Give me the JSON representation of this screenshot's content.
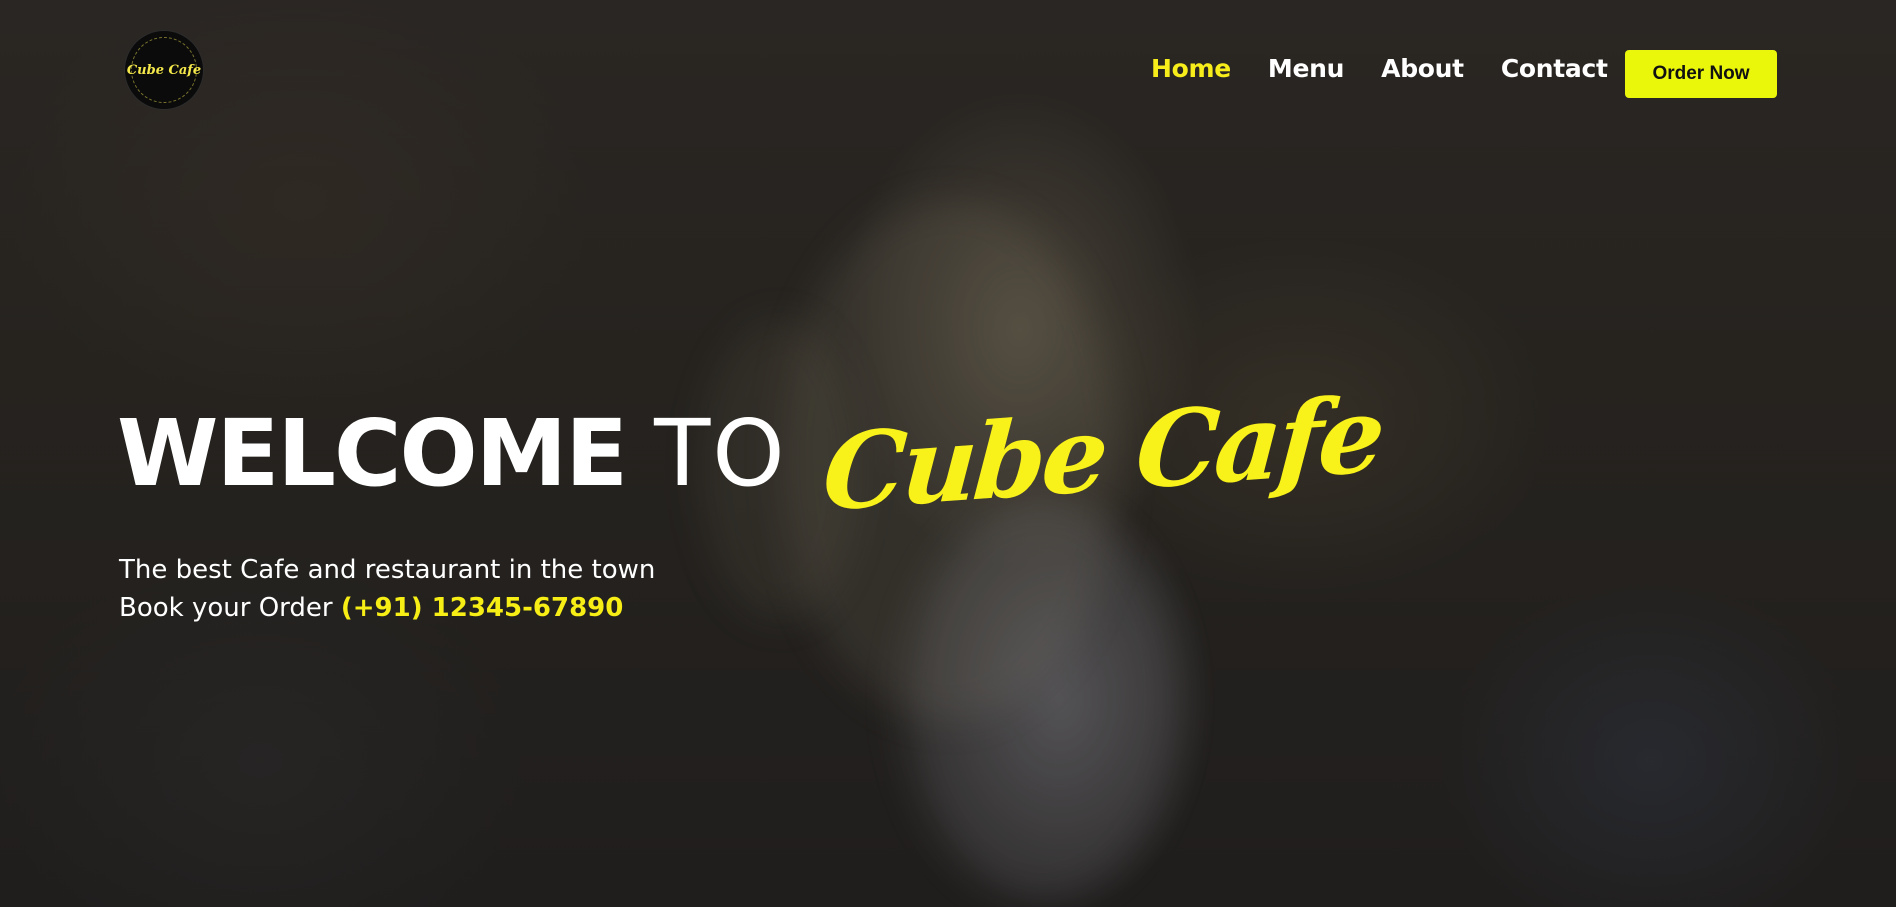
{
  "logo": {
    "text": "Cube Cafe"
  },
  "nav": {
    "links": [
      {
        "label": "Home",
        "active": true
      },
      {
        "label": "Menu",
        "active": false
      },
      {
        "label": "About",
        "active": false
      },
      {
        "label": "Contact",
        "active": false
      }
    ],
    "cta_label": "Order Now"
  },
  "hero": {
    "welcome": "WELCOME",
    "to": "TO",
    "brand": "Cube Cafe",
    "tagline": "The best Cafe and restaurant in the town",
    "book_label": "Book your Order",
    "phone": "(+91) 12345-67890"
  },
  "colors": {
    "accent": "#f7ed1a",
    "button": "#eaf70b",
    "text": "#ffffff",
    "background": "#24211f"
  }
}
